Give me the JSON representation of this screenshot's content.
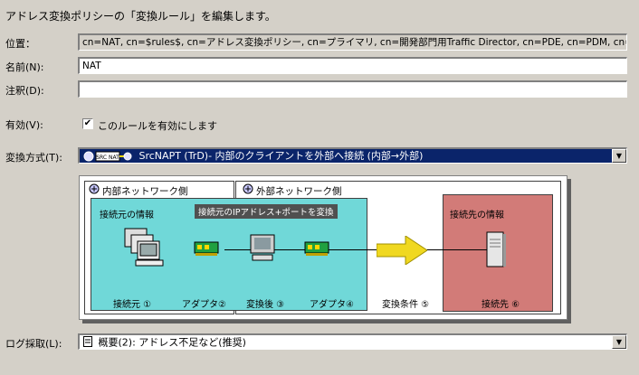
{
  "header": "アドレス変換ポリシーの「変換ルール」を編集します。",
  "location": {
    "label": "位置：",
    "value": "cn=NAT, cn=$rules$, cn=アドレス変換ポリシー, cn=プライマリ, cn=開発部門用Traffic Director, cn=PDE, cn=PDM, cn=doma"
  },
  "name": {
    "label": "名前(N):",
    "value": "NAT"
  },
  "comment": {
    "label": "注釈(D):",
    "value": ""
  },
  "enabled": {
    "label": "有効(V):",
    "checkbox_label": "このルールを有効にします",
    "checked": true
  },
  "conversion": {
    "label": "変換方式(T):",
    "icon_text": "SRC NAT",
    "selected": "SrcNAPT (TrD)- 内部のクライアントを外部へ接続 (内部→外部)"
  },
  "diagram": {
    "internal_title": "内部ネットワーク側",
    "external_title": "外部ネットワーク側",
    "source_info": "接続元の情報",
    "tooltip": "接続元のIPアドレス+ポートを変換",
    "dest_info": "接続先の情報",
    "source": "接続元 ①",
    "adapter2": "アダプタ②",
    "after_conversion": "変換後 ③",
    "adapter4": "アダプタ④",
    "condition": "変換条件 ⑤",
    "destination": "接続先 ⑥"
  },
  "log": {
    "label": "ログ採取(L):",
    "selected": "概要(2): アドレス不足など(推奨)"
  },
  "colors": {
    "selection": "#0a246a",
    "internal_zone": "#70d8d8",
    "destination_zone": "#d27b78",
    "arrow": "#f0d820"
  }
}
